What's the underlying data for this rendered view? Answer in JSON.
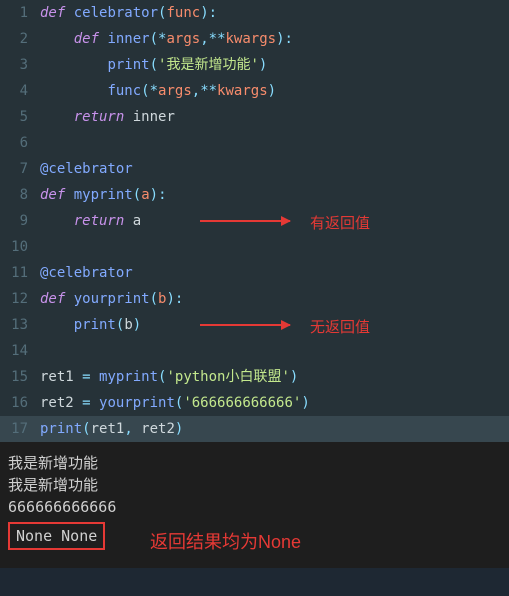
{
  "code": {
    "lines": [
      {
        "n": "1"
      },
      {
        "n": "2"
      },
      {
        "n": "3"
      },
      {
        "n": "4"
      },
      {
        "n": "5"
      },
      {
        "n": "6"
      },
      {
        "n": "7"
      },
      {
        "n": "8"
      },
      {
        "n": "9"
      },
      {
        "n": "10"
      },
      {
        "n": "11"
      },
      {
        "n": "12"
      },
      {
        "n": "13"
      },
      {
        "n": "14"
      },
      {
        "n": "15"
      },
      {
        "n": "16"
      },
      {
        "n": "17"
      }
    ],
    "l1": {
      "def": "def",
      "fn": "celebrator",
      "lp": "(",
      "p": "func",
      "rp": ")",
      "c": ":"
    },
    "l2": {
      "def": "def",
      "fn": "inner",
      "lp": "(",
      "star": "*",
      "a1": "args",
      "comma": ",",
      "dstar": "**",
      "a2": "kwargs",
      "rp": ")",
      "c": ":"
    },
    "l3": {
      "print": "print",
      "lp": "(",
      "s": "'我是新增功能'",
      "rp": ")"
    },
    "l4": {
      "func": "func",
      "lp": "(",
      "star": "*",
      "a1": "args",
      "comma": ",",
      "dstar": "**",
      "a2": "kwargs",
      "rp": ")"
    },
    "l5": {
      "ret": "return",
      "v": "inner"
    },
    "l7": {
      "dec": "@celebrator"
    },
    "l8": {
      "def": "def",
      "fn": "myprint",
      "lp": "(",
      "p": "a",
      "rp": ")",
      "c": ":"
    },
    "l9": {
      "ret": "return",
      "v": "a"
    },
    "l11": {
      "dec": "@celebrator"
    },
    "l12": {
      "def": "def",
      "fn": "yourprint",
      "lp": "(",
      "p": "b",
      "rp": ")",
      "c": ":"
    },
    "l13": {
      "print": "print",
      "lp": "(",
      "p": "b",
      "rp": ")"
    },
    "l15": {
      "v": "ret1",
      "eq": " = ",
      "fn": "myprint",
      "lp": "(",
      "s": "'python小白联盟'",
      "rp": ")"
    },
    "l16": {
      "v": "ret2",
      "eq": " = ",
      "fn": "yourprint",
      "lp": "(",
      "s": "'666666666666'",
      "rp": ")"
    },
    "l17": {
      "print": "print",
      "lp": "(",
      "a1": "ret1",
      "comma": ", ",
      "a2": "ret2",
      "rp": ")"
    }
  },
  "annotations": {
    "hasReturn": "有返回值",
    "noReturn": "无返回值",
    "resultNone": "返回结果均为None"
  },
  "output": {
    "o1": "我是新增功能",
    "o2": "我是新增功能",
    "o3": "666666666666",
    "none": "None None"
  }
}
